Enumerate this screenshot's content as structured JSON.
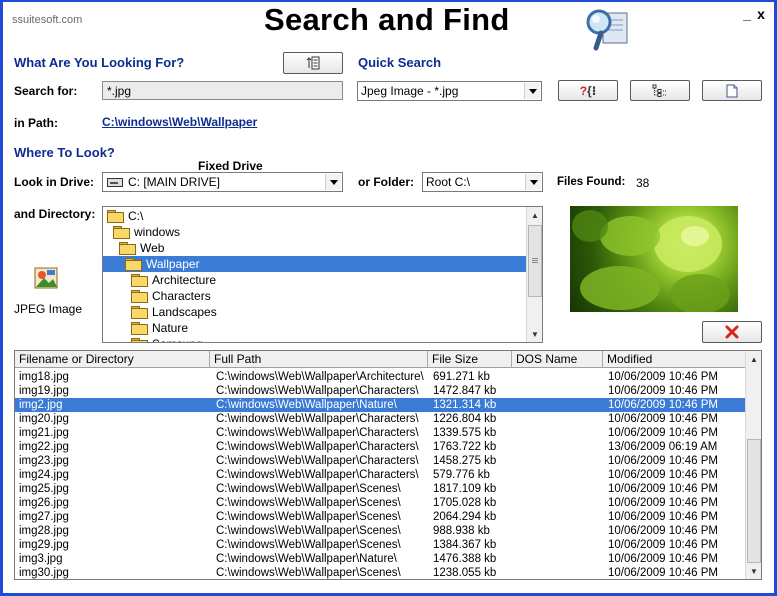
{
  "app": {
    "brand": "ssuitesoft.com",
    "title": "Search and Find",
    "minimize": "_",
    "close": "x"
  },
  "what": {
    "heading": "What Are You Looking For?",
    "search_label": "Search for:",
    "search_value": "*.jpg",
    "path_label": "in Path:",
    "path_value": "C:\\windows\\Web\\Wallpaper"
  },
  "quick": {
    "heading": "Quick Search",
    "selected": "Jpeg Image - *.jpg"
  },
  "where": {
    "heading": "Where To Look?",
    "drive_label": "Look in Drive:",
    "fixed_drive_label": "Fixed Drive",
    "drive_value": "C: [MAIN DRIVE]",
    "folder_label": "or Folder:",
    "folder_value": "Root C:\\",
    "files_found_label": "Files Found:",
    "files_found_value": "38",
    "directory_label": "and Directory:",
    "filetype_label": "JPEG Image"
  },
  "tree": [
    {
      "label": "C:\\",
      "level": 0
    },
    {
      "label": "windows",
      "level": 1
    },
    {
      "label": "Web",
      "level": 2
    },
    {
      "label": "Wallpaper",
      "level": 3,
      "selected": true
    },
    {
      "label": "Architecture",
      "level": 4
    },
    {
      "label": "Characters",
      "level": 4
    },
    {
      "label": "Landscapes",
      "level": 4
    },
    {
      "label": "Nature",
      "level": 4
    },
    {
      "label": "Samsung",
      "level": 4
    }
  ],
  "results": {
    "columns": [
      "Filename or Directory",
      "Full Path",
      "File Size",
      "DOS Name",
      "Modified"
    ],
    "rows": [
      [
        "img18.jpg",
        "C:\\windows\\Web\\Wallpaper\\Architecture\\",
        "691.271 kb",
        "",
        "10/06/2009 10:46 PM"
      ],
      [
        "img19.jpg",
        "C:\\windows\\Web\\Wallpaper\\Characters\\",
        "1472.847 kb",
        "",
        "10/06/2009 10:46 PM"
      ],
      [
        "img2.jpg",
        "C:\\windows\\Web\\Wallpaper\\Nature\\",
        "1321.314 kb",
        "",
        "10/06/2009 10:46 PM"
      ],
      [
        "img20.jpg",
        "C:\\windows\\Web\\Wallpaper\\Characters\\",
        "1226.804 kb",
        "",
        "10/06/2009 10:46 PM"
      ],
      [
        "img21.jpg",
        "C:\\windows\\Web\\Wallpaper\\Characters\\",
        "1339.575 kb",
        "",
        "10/06/2009 10:46 PM"
      ],
      [
        "img22.jpg",
        "C:\\windows\\Web\\Wallpaper\\Characters\\",
        "1763.722 kb",
        "",
        "13/06/2009 06:19 AM"
      ],
      [
        "img23.jpg",
        "C:\\windows\\Web\\Wallpaper\\Characters\\",
        "1458.275 kb",
        "",
        "10/06/2009 10:46 PM"
      ],
      [
        "img24.jpg",
        "C:\\windows\\Web\\Wallpaper\\Characters\\",
        "579.776 kb",
        "",
        "10/06/2009 10:46 PM"
      ],
      [
        "img25.jpg",
        "C:\\windows\\Web\\Wallpaper\\Scenes\\",
        "1817.109 kb",
        "",
        "10/06/2009 10:46 PM"
      ],
      [
        "img26.jpg",
        "C:\\windows\\Web\\Wallpaper\\Scenes\\",
        "1705.028 kb",
        "",
        "10/06/2009 10:46 PM"
      ],
      [
        "img27.jpg",
        "C:\\windows\\Web\\Wallpaper\\Scenes\\",
        "2064.294 kb",
        "",
        "10/06/2009 10:46 PM"
      ],
      [
        "img28.jpg",
        "C:\\windows\\Web\\Wallpaper\\Scenes\\",
        "988.938 kb",
        "",
        "10/06/2009 10:46 PM"
      ],
      [
        "img29.jpg",
        "C:\\windows\\Web\\Wallpaper\\Scenes\\",
        "1384.367 kb",
        "",
        "10/06/2009 10:46 PM"
      ],
      [
        "img3.jpg",
        "C:\\windows\\Web\\Wallpaper\\Nature\\",
        "1476.388 kb",
        "",
        "10/06/2009 10:46 PM"
      ],
      [
        "img30.jpg",
        "C:\\windows\\Web\\Wallpaper\\Scenes\\",
        "1238.055 kb",
        "",
        "10/06/2009 10:46 PM"
      ]
    ],
    "selected_index": 2
  },
  "colors": {
    "frame": "#1f4bd6",
    "heading": "#0d2c8f",
    "selection": "#3a7bd5",
    "delete_icon": "#d9261c"
  },
  "icons": {
    "app_logo": "magnifier-document-icon",
    "toggle_button": "list-sort-icon",
    "help_button": "question-brace-icon",
    "tree_button": "tree-list-icon",
    "new_button": "blank-page-icon",
    "filetype": "jpeg-image-icon",
    "delete_button": "red-x-icon"
  }
}
